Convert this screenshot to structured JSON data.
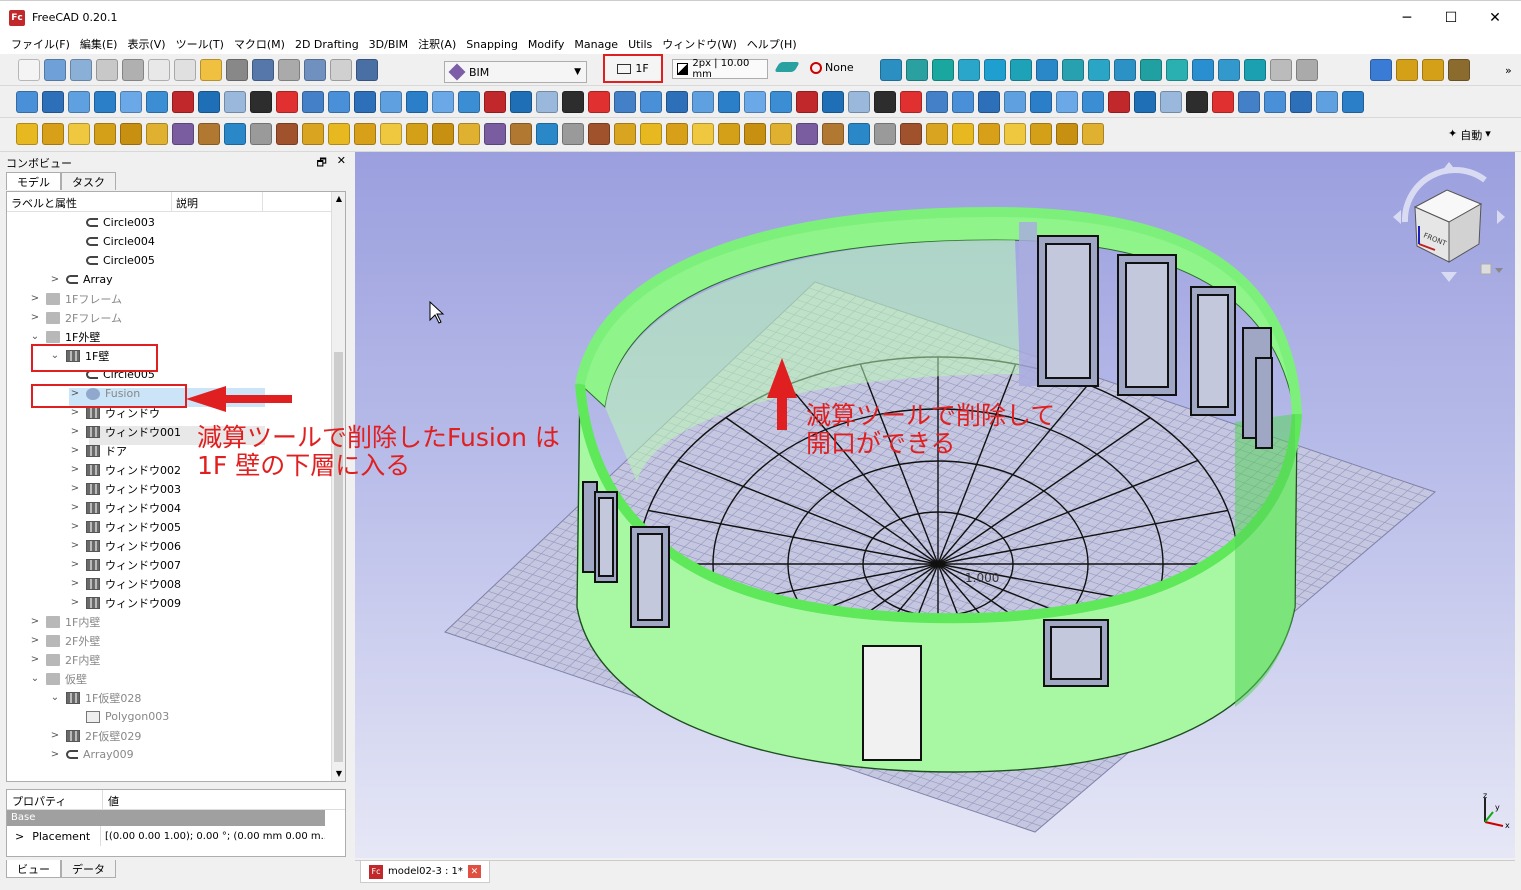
{
  "window": {
    "title": "FreeCAD 0.20.1",
    "icon_label": "Fc",
    "controls": {
      "minimize": "─",
      "maximize": "☐",
      "close": "✕"
    }
  },
  "menu": [
    "ファイル(F)",
    "編集(E)",
    "表示(V)",
    "ツール(T)",
    "マクロ(M)",
    "2D Drafting",
    "3D/BIM",
    "注釈(A)",
    "Snapping",
    "Modify",
    "Manage",
    "Utils",
    "ウィンドウ(W)",
    "ヘルプ(H)"
  ],
  "toolbar": {
    "workbench": "BIM",
    "level": "1F",
    "line_style": "2px | 10.00 mm",
    "none_label": "None",
    "auto_label": "自動",
    "more": "»"
  },
  "panel": {
    "title": "コンボビュー",
    "tabs": [
      "モデル",
      "タスク"
    ],
    "columns": [
      "ラベルと属性",
      "説明"
    ],
    "float_icon": "🗗",
    "close_icon": "✕"
  },
  "tree": [
    {
      "label": "Circle003",
      "icon": "link",
      "expander": "",
      "depth": 3,
      "grey": false
    },
    {
      "label": "Circle004",
      "icon": "link",
      "expander": "",
      "depth": 3,
      "grey": false
    },
    {
      "label": "Circle005",
      "icon": "link",
      "expander": "",
      "depth": 3,
      "grey": false
    },
    {
      "label": "Array",
      "icon": "link",
      "expander": ">",
      "depth": 2,
      "grey": false
    },
    {
      "label": "1Fフレーム",
      "icon": "folder",
      "expander": ">",
      "depth": 1,
      "grey": true
    },
    {
      "label": "2Fフレーム",
      "icon": "folder",
      "expander": ">",
      "depth": 1,
      "grey": true
    },
    {
      "label": "1F外壁",
      "icon": "folder",
      "expander": "v",
      "depth": 1,
      "grey": false
    },
    {
      "label": "1F壁",
      "icon": "obj",
      "expander": "v",
      "depth": 2,
      "grey": false
    },
    {
      "label": "Circle005",
      "icon": "link",
      "expander": "",
      "depth": 3,
      "grey": false
    },
    {
      "label": "Fusion",
      "icon": "fusion",
      "expander": ">",
      "depth": 3,
      "grey": true
    },
    {
      "label": "ウィンドウ",
      "icon": "obj",
      "expander": ">",
      "depth": 3,
      "grey": false
    },
    {
      "label": "ウィンドウ001",
      "icon": "obj",
      "expander": ">",
      "depth": 3,
      "grey": false
    },
    {
      "label": "ドア",
      "icon": "obj",
      "expander": ">",
      "depth": 3,
      "grey": false
    },
    {
      "label": "ウィンドウ002",
      "icon": "obj",
      "expander": ">",
      "depth": 3,
      "grey": false
    },
    {
      "label": "ウィンドウ003",
      "icon": "obj",
      "expander": ">",
      "depth": 3,
      "grey": false
    },
    {
      "label": "ウィンドウ004",
      "icon": "obj",
      "expander": ">",
      "depth": 3,
      "grey": false
    },
    {
      "label": "ウィンドウ005",
      "icon": "obj",
      "expander": ">",
      "depth": 3,
      "grey": false
    },
    {
      "label": "ウィンドウ006",
      "icon": "obj",
      "expander": ">",
      "depth": 3,
      "grey": false
    },
    {
      "label": "ウィンドウ007",
      "icon": "obj",
      "expander": ">",
      "depth": 3,
      "grey": false
    },
    {
      "label": "ウィンドウ008",
      "icon": "obj",
      "expander": ">",
      "depth": 3,
      "grey": false
    },
    {
      "label": "ウィンドウ009",
      "icon": "obj",
      "expander": ">",
      "depth": 3,
      "grey": false
    },
    {
      "label": "1F内壁",
      "icon": "folder",
      "expander": ">",
      "depth": 1,
      "grey": true
    },
    {
      "label": "2F外壁",
      "icon": "folder",
      "expander": ">",
      "depth": 1,
      "grey": true
    },
    {
      "label": "2F内壁",
      "icon": "folder",
      "expander": ">",
      "depth": 1,
      "grey": true
    },
    {
      "label": "仮壁",
      "icon": "folder",
      "expander": "v",
      "depth": 1,
      "grey": true
    },
    {
      "label": "1F仮壁028",
      "icon": "obj",
      "expander": "v",
      "depth": 2,
      "grey": true
    },
    {
      "label": "Polygon003",
      "icon": "poly",
      "expander": "",
      "depth": 3,
      "grey": true
    },
    {
      "label": "2F仮壁029",
      "icon": "obj",
      "expander": ">",
      "depth": 2,
      "grey": true
    },
    {
      "label": "Array009",
      "icon": "link",
      "expander": ">",
      "depth": 2,
      "grey": true
    }
  ],
  "properties": {
    "columns": [
      "プロパティ",
      "値"
    ],
    "group": "Base",
    "rows": [
      {
        "key": "Placement",
        "value": "[(0.00 0.00 1.00); 0.00 °; (0.00 mm  0.00 m..."
      }
    ]
  },
  "bottom_tabs": [
    "ビュー",
    "データ"
  ],
  "document_tab": {
    "label": "model02-3 : 1*",
    "close": "✕"
  },
  "annotations": {
    "left": [
      "減算ツールで削除したFusion は",
      "1F 壁の下層に入る"
    ],
    "right": [
      "減算ツールで削除して",
      "開口ができる"
    ]
  },
  "viewport": {
    "grid_label": "1.000",
    "navcube_face": "FRONT",
    "axis_labels": {
      "x": "x",
      "y": "y",
      "z": "z"
    }
  },
  "colors": {
    "wall": "#7ef07a",
    "annotation": "#e02020",
    "bg_top": "#9b9fde",
    "bg_bottom": "#e6e7f6"
  }
}
